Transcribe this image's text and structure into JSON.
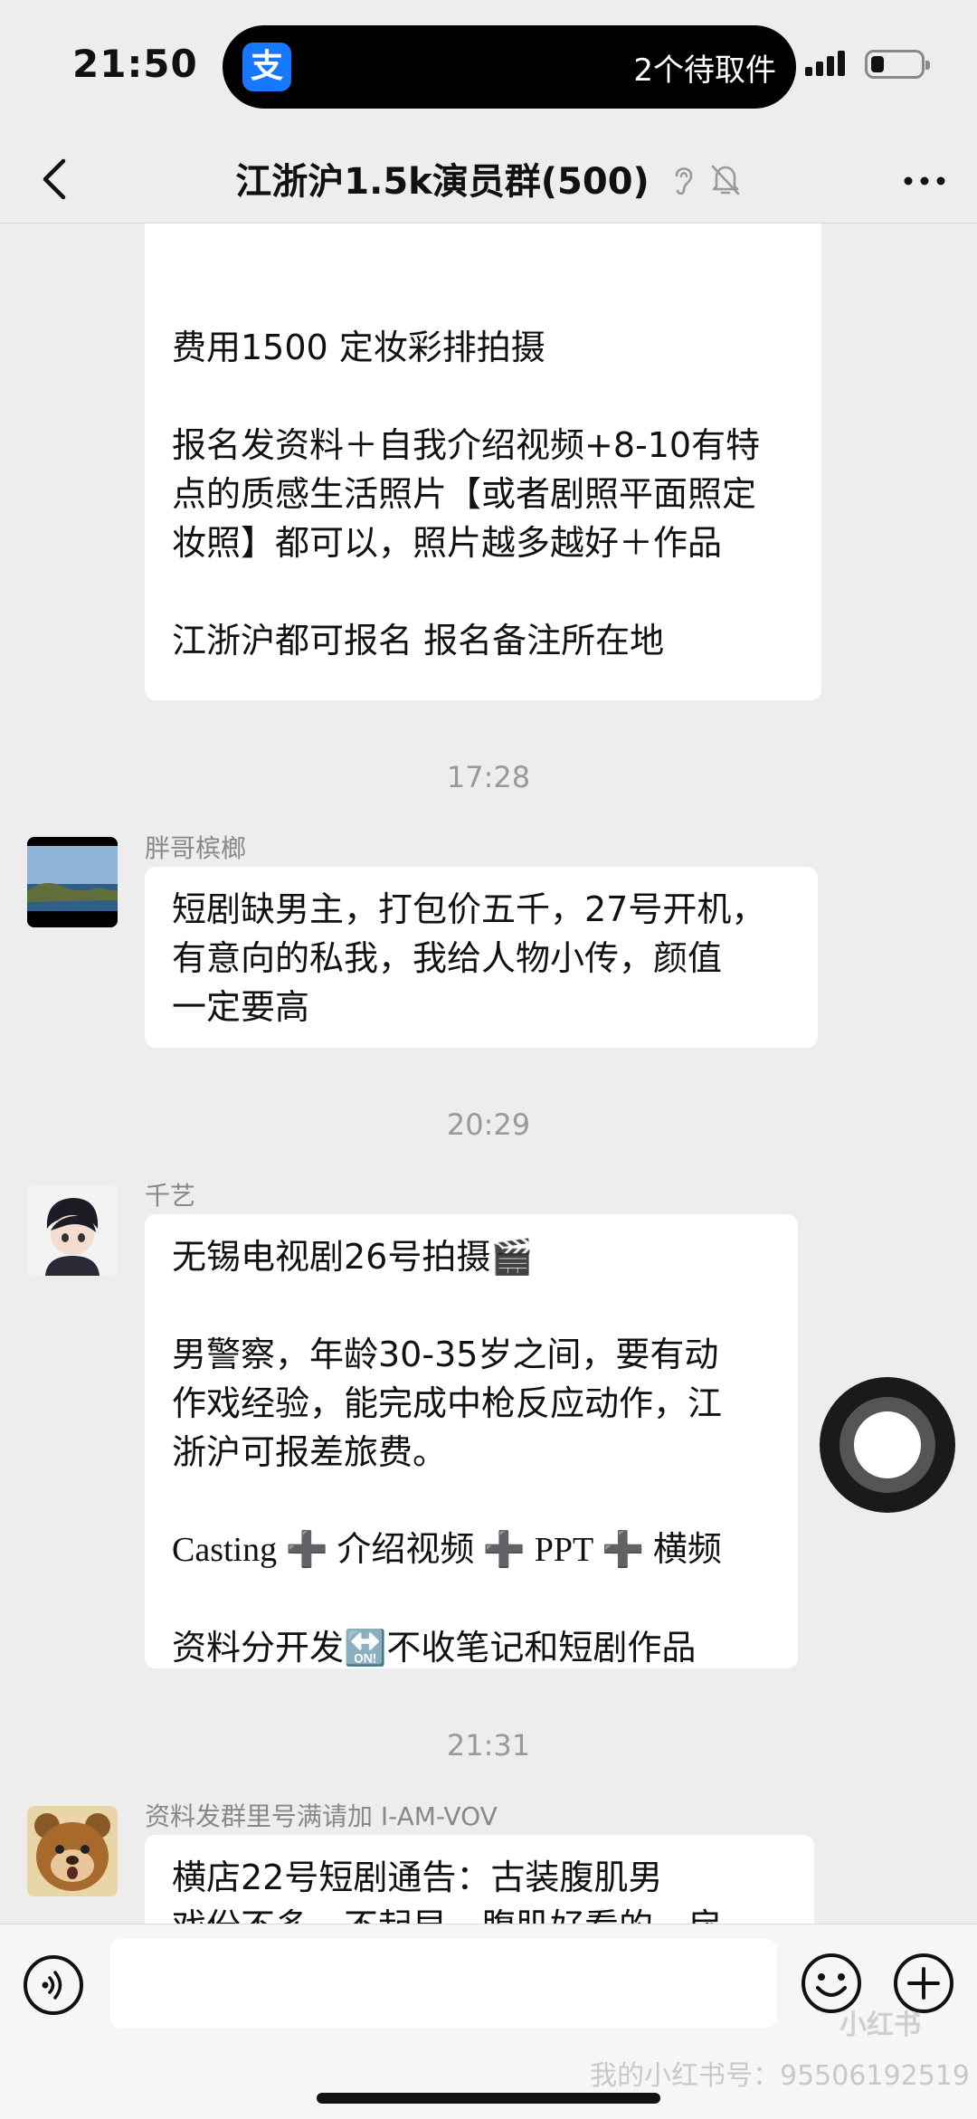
{
  "status_bar": {
    "time": "21:50",
    "alipay_glyph": "支",
    "pickup_text": "2个待取件"
  },
  "nav": {
    "title": "江浙沪1.5k演员群(500)",
    "back_icon": "chevron-left-icon",
    "more_icon": "more-dots-icon"
  },
  "messages": [
    {
      "type": "continued",
      "paragraphs": [
        [
          "费用1500 定妆彩排拍摄"
        ],
        [
          "报名发资料＋自我介绍视频+8-10有特",
          "点的质感生活照片【或者剧照平面照定",
          "妆照】都可以，照片越多越好＋作品"
        ],
        [
          "江浙沪都可报名 报名备注所在地"
        ]
      ]
    },
    {
      "timestamp": "17:28",
      "sender": "胖哥槟榔",
      "paragraphs": [
        [
          "短剧缺男主，打包价五千，27号开机，",
          "有意向的私我，我给人物小传，颜值",
          "一定要高"
        ]
      ]
    },
    {
      "timestamp": "20:29",
      "sender": "千艺",
      "paragraphs": [
        [
          "无锡电视剧26号拍摄🎬"
        ],
        [
          "男警察，年龄30-35岁之间，要有动",
          "作戏经验，能完成中枪反应动作，江",
          "浙沪可报差旅费。"
        ],
        [
          "Casting ➕ 介绍视频 ➕ PPT ➕ 横频"
        ],
        [
          "资料分开发🔛不收笔记和短剧作品"
        ]
      ]
    },
    {
      "timestamp": "21:31",
      "sender": "资料发群里号满请加 I-AM-VOV",
      "paragraphs": [
        [
          "横店22号短剧通告：古装腹肌男",
          "戏份不多，不起早，腹肌好看的，戾"
        ]
      ]
    }
  ],
  "input_bar": {
    "watermark": "我的小红书号：9550619251​9",
    "badge": "小红书"
  },
  "colors": {
    "background": "#ededed",
    "bubble": "#ffffff",
    "alipay_blue": "#1677ff"
  }
}
